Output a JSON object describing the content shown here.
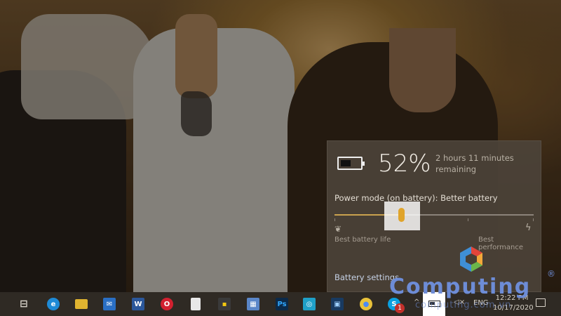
{
  "battery_flyout": {
    "percent": "52%",
    "time_line1": "2 hours 11 minutes",
    "time_line2": "remaining",
    "power_mode_label": "Power mode (on battery): Better battery",
    "slider_level_fraction": 0.33,
    "left_label": "Best battery life",
    "right_label": "Best performance",
    "settings_link": "Battery settings"
  },
  "taskbar": {
    "apps": [
      {
        "name": "task-view",
        "icon": "task-view-icon",
        "glyph": "⊟",
        "color": "#2f2a24",
        "fg": "#d8d2c8"
      },
      {
        "name": "edge",
        "icon": "edge-icon",
        "glyph": "e",
        "color": "#1e8ad6",
        "fg": "#ffffff"
      },
      {
        "name": "file-explorer",
        "icon": "folder-icon",
        "glyph": "",
        "color": "#e0b430",
        "fg": "#ffffff"
      },
      {
        "name": "mail",
        "icon": "mail-icon",
        "glyph": "✉",
        "color": "#2a6fc4",
        "fg": "#ffffff"
      },
      {
        "name": "word",
        "icon": "word-icon",
        "glyph": "W",
        "color": "#2b579a",
        "fg": "#ffffff"
      },
      {
        "name": "opera",
        "icon": "opera-icon",
        "glyph": "O",
        "color": "#d2202f",
        "fg": "#ffffff"
      },
      {
        "name": "blank-document",
        "icon": "document-icon",
        "glyph": "",
        "color": "#e8e8e8",
        "fg": "#ffffff"
      },
      {
        "name": "store",
        "icon": "store-icon",
        "glyph": "▪",
        "color": "#3a3a3a",
        "fg": "#f2c811"
      },
      {
        "name": "photo-app",
        "icon": "photo-icon",
        "glyph": "▦",
        "color": "#5a86c8",
        "fg": "#ffffff"
      },
      {
        "name": "photoshop",
        "icon": "photoshop-icon",
        "glyph": "Ps",
        "color": "#0b2a4a",
        "fg": "#31a8ff"
      },
      {
        "name": "camera-app",
        "icon": "camera-icon",
        "glyph": "◎",
        "color": "#1fa0c8",
        "fg": "#ffffff"
      },
      {
        "name": "virtualbox",
        "icon": "virtualbox-icon",
        "glyph": "▣",
        "color": "#183a61",
        "fg": "#9fd0ff"
      },
      {
        "name": "chrome",
        "icon": "chrome-icon",
        "glyph": "●",
        "color": "#2f2a24",
        "fg": "#4c8bf5"
      },
      {
        "name": "skype",
        "icon": "skype-icon",
        "glyph": "S",
        "color": "#0aa0e0",
        "fg": "#ffffff"
      }
    ],
    "notification_badge": "1",
    "tray_chevron": "^",
    "volume_glyph": "◁×",
    "language": "ENG",
    "time": "12:22 PM",
    "date": "10/17/2020"
  },
  "watermark": {
    "word": "Computing",
    "registered": "®",
    "site": "computing.com.vn",
    "colors": [
      "#e3453a",
      "#f2a83a",
      "#6bb64a",
      "#3f8fd6"
    ]
  }
}
